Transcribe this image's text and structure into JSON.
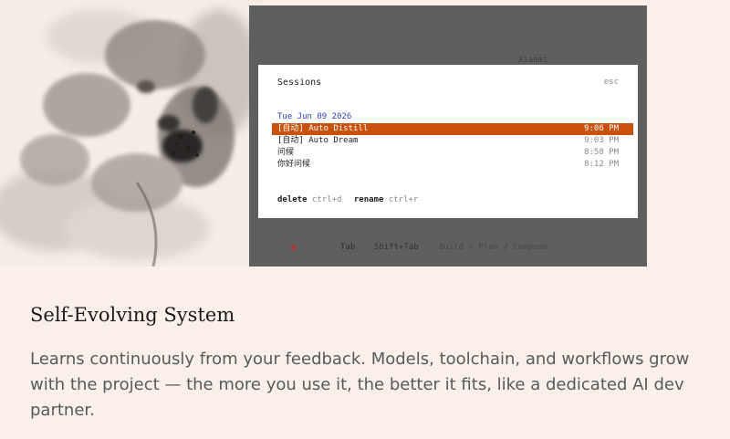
{
  "terminal": {
    "model_label": "Xiaomi",
    "footer": {
      "tab_key": "Tab",
      "shift_tab_key": "Shift+Tab",
      "modes": "Build / Plan / Compose"
    }
  },
  "sessions_modal": {
    "title": "Sessions",
    "close_hint": "esc",
    "group_date": "Tue Jun 09 2026",
    "items": [
      {
        "name": "[自动] Auto Distill",
        "time": "9:06 PM",
        "selected": true
      },
      {
        "name": "[自动] Auto Dream",
        "time": "9:03 PM",
        "selected": false
      },
      {
        "name": "问候",
        "time": "8:58 PM",
        "selected": false
      },
      {
        "name": "你好问候",
        "time": "8:12 PM",
        "selected": false
      }
    ],
    "footer": {
      "delete_label": "delete",
      "delete_shortcut": "ctrl+d",
      "rename_label": "rename",
      "rename_shortcut": "ctrl+r"
    }
  },
  "feature": {
    "title": "Self-Evolving System",
    "description": "Learns continuously from your feedback. Models, toolchain, and workflows grow with the project — the more you use it, the better it fits, like a dedicated AI dev partner."
  },
  "colors": {
    "page_background": "#faf0e9",
    "terminal_background": "#5f5f5f",
    "selection_accent": "#c9510c",
    "date_accent": "#2f3fb8"
  }
}
